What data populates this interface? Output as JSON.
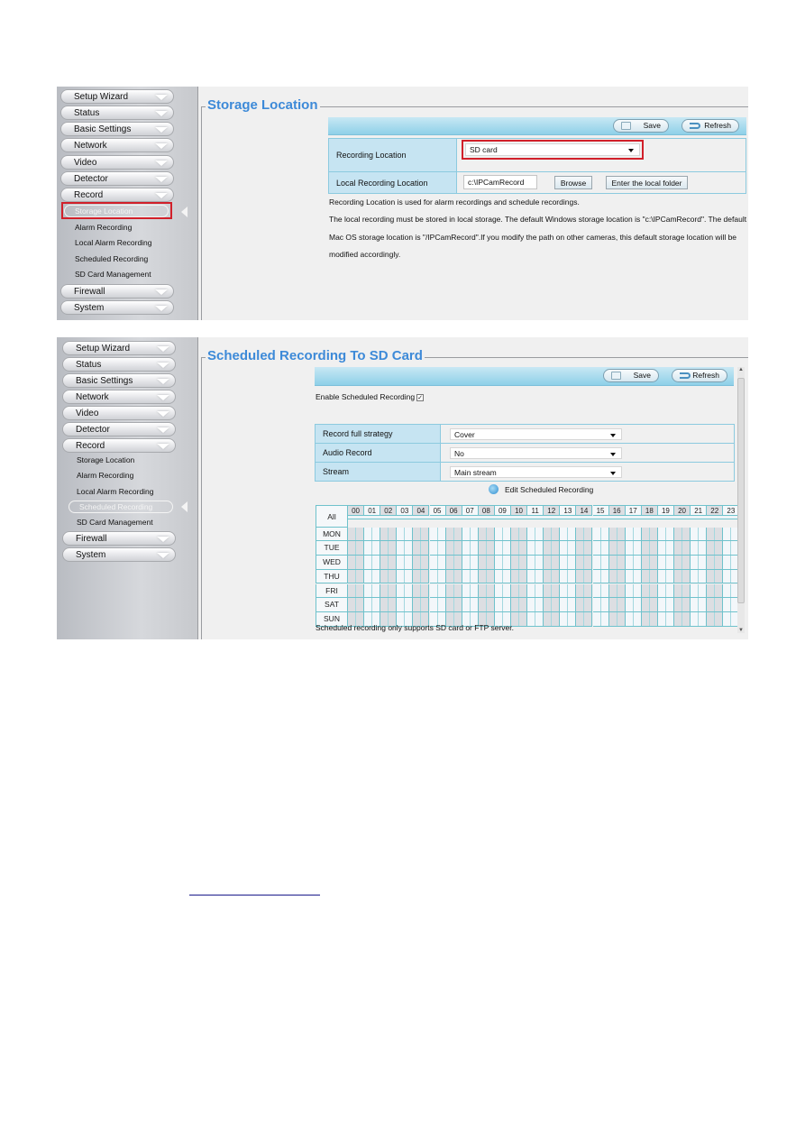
{
  "sidebar_menu": [
    "Setup Wizard",
    "Status",
    "Basic Settings",
    "Network",
    "Video",
    "Detector",
    "Record"
  ],
  "record_submenu": [
    "Storage Location",
    "Alarm Recording",
    "Local Alarm Recording",
    "Scheduled Recording",
    "SD Card Management"
  ],
  "sidebar_bottom": [
    "Firewall",
    "System"
  ],
  "shot1": {
    "active_submenu": "Storage Location",
    "section_title": "Storage Location",
    "toolbar": {
      "save_label": "Save",
      "refresh_label": "Refresh"
    },
    "recording_location_label": "Recording Location",
    "recording_location_value": "SD card",
    "local_recording_label": "Local Recording Location",
    "local_recording_value": "c:\\IPCamRecord",
    "browse_label": "Browse",
    "enter_folder_label": "Enter the local folder",
    "description": [
      "Recording Location is used for alarm recordings and schedule recordings.",
      "The local recording must be stored in local storage. The default Windows storage location is \"c:\\IPCamRecord\". The default",
      "Mac OS storage location is \"/IPCamRecord\".If you modify the path on other cameras, this default storage location will be",
      "modified accordingly."
    ]
  },
  "shot2": {
    "active_submenu": "Scheduled Recording",
    "section_title": "Scheduled Recording To SD Card",
    "toolbar": {
      "save_label": "Save",
      "refresh_label": "Refresh"
    },
    "enable_label": "Enable Scheduled Recording",
    "enable_checked": true,
    "check_mark": "✓",
    "fields": [
      {
        "label": "Record full strategy",
        "value": "Cover"
      },
      {
        "label": "Audio Record",
        "value": "No"
      },
      {
        "label": "Stream",
        "value": "Main stream"
      }
    ],
    "edit_label": "Edit Scheduled Recording",
    "schedule": {
      "all_label": "All",
      "hours": [
        "00",
        "01",
        "02",
        "03",
        "04",
        "05",
        "06",
        "07",
        "08",
        "09",
        "10",
        "11",
        "12",
        "13",
        "14",
        "15",
        "16",
        "17",
        "18",
        "19",
        "20",
        "21",
        "22",
        "23"
      ],
      "days": [
        "MON",
        "TUE",
        "WED",
        "THU",
        "FRI",
        "SAT",
        "SUN"
      ]
    },
    "footnote": "Scheduled recording only supports SD card or FTP server."
  }
}
